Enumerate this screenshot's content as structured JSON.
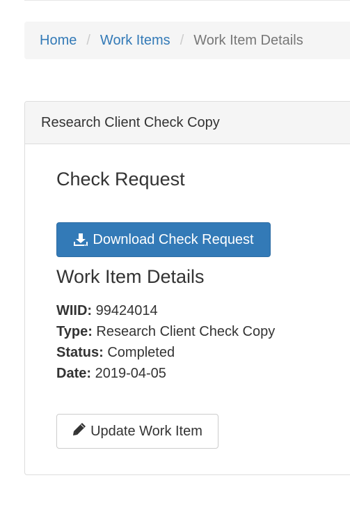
{
  "breadcrumb": {
    "home": "Home",
    "work_items": "Work Items",
    "current": "Work Item Details",
    "separator": "/"
  },
  "panel": {
    "heading": "Research Client Check Copy",
    "check_request_title": "Check Request",
    "download_button": {
      "label": "Download Check Request",
      "icon": "download-icon"
    },
    "details_title": "Work Item Details",
    "fields": [
      {
        "label": "WIID:",
        "value": "99424014"
      },
      {
        "label": "Type:",
        "value": "Research Client Check Copy"
      },
      {
        "label": "Status:",
        "value": "Completed"
      },
      {
        "label": "Date:",
        "value": "2019-04-05"
      }
    ],
    "update_button": {
      "label": "Update Work Item",
      "icon": "pencil-icon"
    }
  },
  "colors": {
    "primary": "#337ab7",
    "link": "#337ab7",
    "breadcrumb_bg": "#f5f5f5",
    "panel_border": "#dddddd"
  }
}
